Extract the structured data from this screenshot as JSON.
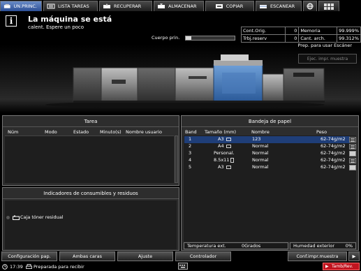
{
  "tabs": [
    {
      "label": "UN.PRINC.",
      "icon": "home-icon",
      "active": true
    },
    {
      "label": "LISTA TAREAS",
      "icon": "job-list-icon"
    },
    {
      "label": "RECUPERAR",
      "icon": "recall-icon"
    },
    {
      "label": "ALMACENAR",
      "icon": "store-icon"
    },
    {
      "label": "COPIAR",
      "icon": "copy-icon"
    },
    {
      "label": "ESCANEAR",
      "icon": "scan-icon"
    }
  ],
  "status": {
    "line1": "La máquina se está",
    "line2": "calent. Espere un poco",
    "toner_label": "Cuerpo prin.",
    "toner_level": 0.12,
    "prep_text": "Prep. para usar Escáner",
    "ejec_label": "Ejec. impr. muestra"
  },
  "counters": {
    "cont_orig_label": "Cont.Orig.",
    "cont_orig_value": "0",
    "memoria_label": "Memoria",
    "memoria_value": "99.999%",
    "trbj_reserv_label": "Trbj.reserv",
    "trbj_reserv_value": "0",
    "cant_arch_label": "Cant. arch.",
    "cant_arch_value": "99.312%"
  },
  "tarea": {
    "title": "Tarea",
    "headers": [
      "Núm",
      "Modo",
      "Estado",
      "Minuto(s)",
      "Nombre usuario"
    ]
  },
  "consumibles": {
    "title": "Indicadores de consumibles y residuos",
    "item": "Caja tóner residual"
  },
  "bandeja": {
    "title": "Bandeja de papel",
    "headers": [
      "Band",
      "Tamaño (mm)",
      "Nombre",
      "Peso"
    ],
    "rows": [
      {
        "band": "1",
        "size": "A3",
        "name": "123",
        "weight": "62-74g/m2",
        "level": 0.3
      },
      {
        "band": "2",
        "size": "A4",
        "name": "Normal",
        "weight": "62-74g/m2",
        "level": 0.3
      },
      {
        "band": "3",
        "size": "Personal.",
        "name": "Normal",
        "weight": "62-74g/m2",
        "level": 1.0
      },
      {
        "band": "4",
        "size": "8.5x11",
        "name": "Normal",
        "weight": "62-74g/m2",
        "level": 0.3
      },
      {
        "band": "5",
        "size": "A3",
        "name": "Normal",
        "weight": "62-74g/m2",
        "level": 1.0
      }
    ],
    "temp_label": "Temperatura ext.",
    "temp_value": "0Grados",
    "hum_label": "Humedad exterior",
    "hum_value": "0%"
  },
  "buttons": {
    "config_pap": "Configuración pap.",
    "ambas_caras": "Ambas caras",
    "ajuste": "Ajuste",
    "controlador": "Controlador",
    "conf_impr": "Conf.impr.muestra",
    "next": "▶"
  },
  "statusbar": {
    "time": "17:39",
    "status": "Preparada para recibir",
    "tamb": "Tamb/Rev."
  }
}
